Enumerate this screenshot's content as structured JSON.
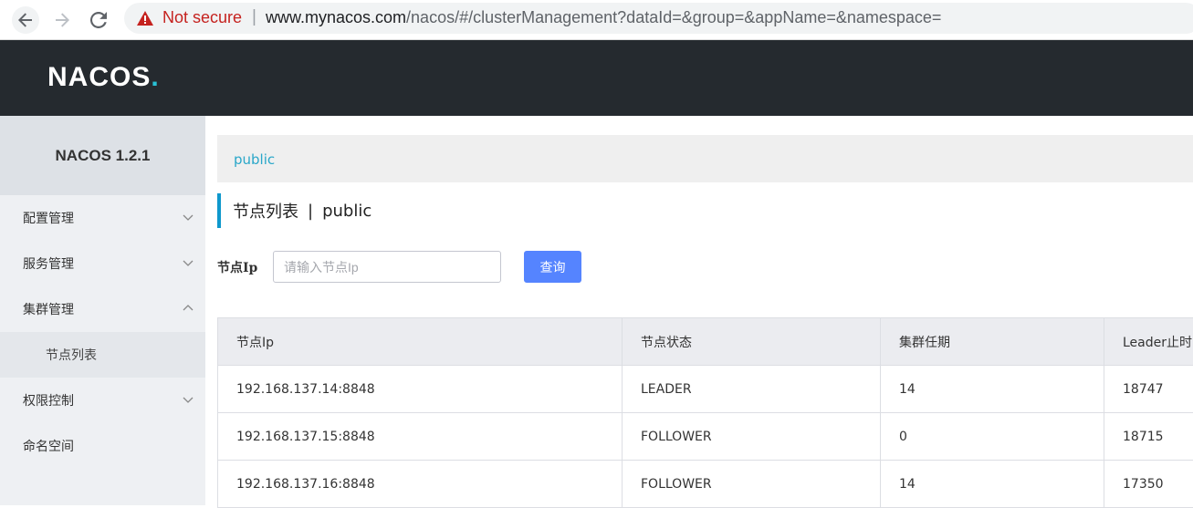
{
  "browser": {
    "not_secure": "Not secure",
    "url_domain": "www.mynacos.com",
    "url_path": "/nacos/#/clusterManagement?dataId=&group=&appName=&namespace="
  },
  "header": {
    "logo": "NACOS",
    "logo_dot": "."
  },
  "sidebar": {
    "title": "NACOS 1.2.1",
    "items": [
      {
        "label": "配置管理",
        "expanded": false
      },
      {
        "label": "服务管理",
        "expanded": false
      },
      {
        "label": "集群管理",
        "expanded": true
      },
      {
        "label": "权限控制",
        "expanded": false
      },
      {
        "label": "命名空间"
      }
    ],
    "subitems": [
      {
        "label": "节点列表"
      }
    ]
  },
  "main": {
    "namespace_link": "public",
    "title": "节点列表",
    "title_sep": "|",
    "title_namespace": "public",
    "filter": {
      "label": "节点Ip",
      "placeholder": "请输入节点Ip",
      "value": "",
      "button": "查询"
    },
    "table": {
      "headers": [
        "节点Ip",
        "节点状态",
        "集群任期",
        "Leader止时("
      ],
      "rows": [
        [
          "192.168.137.14:8848",
          "LEADER",
          "14",
          "18747"
        ],
        [
          "192.168.137.15:8848",
          "FOLLOWER",
          "0",
          "18715"
        ],
        [
          "192.168.137.16:8848",
          "FOLLOWER",
          "14",
          "17350"
        ]
      ]
    }
  },
  "colors": {
    "header_bg": "#252a2f",
    "accent": "#0e98cc",
    "button": "#5584ff",
    "link": "#2aa7c9"
  }
}
